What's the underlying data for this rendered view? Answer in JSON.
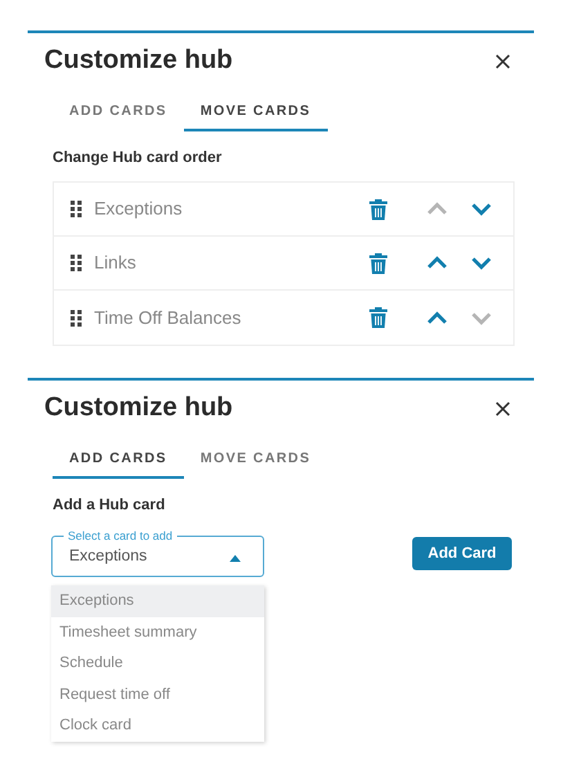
{
  "panels": [
    {
      "kind": "move",
      "title": "Customize hub",
      "tabs": [
        {
          "label": "ADD CARDS",
          "selected": false
        },
        {
          "label": "MOVE CARDS",
          "selected": true
        }
      ],
      "heading": "Change Hub card order",
      "cards": [
        {
          "name": "Exceptions",
          "up_disabled": true,
          "down_disabled": false
        },
        {
          "name": "Links",
          "up_disabled": false,
          "down_disabled": false
        },
        {
          "name": "Time Off Balances",
          "up_disabled": false,
          "down_disabled": true
        }
      ]
    },
    {
      "kind": "add",
      "title": "Customize hub",
      "tabs": [
        {
          "label": "ADD CARDS",
          "selected": true
        },
        {
          "label": "MOVE CARDS",
          "selected": false
        }
      ],
      "heading": "Add a Hub card",
      "select": {
        "label": "Select a card to add",
        "value": "Exceptions",
        "expanded": true
      },
      "button": "Add Card",
      "options": [
        {
          "label": "Exceptions",
          "selected": true
        },
        {
          "label": "Timesheet summary",
          "selected": false
        },
        {
          "label": "Schedule",
          "selected": false
        },
        {
          "label": "Request time off",
          "selected": false
        },
        {
          "label": "Clock card",
          "selected": false
        }
      ]
    }
  ]
}
